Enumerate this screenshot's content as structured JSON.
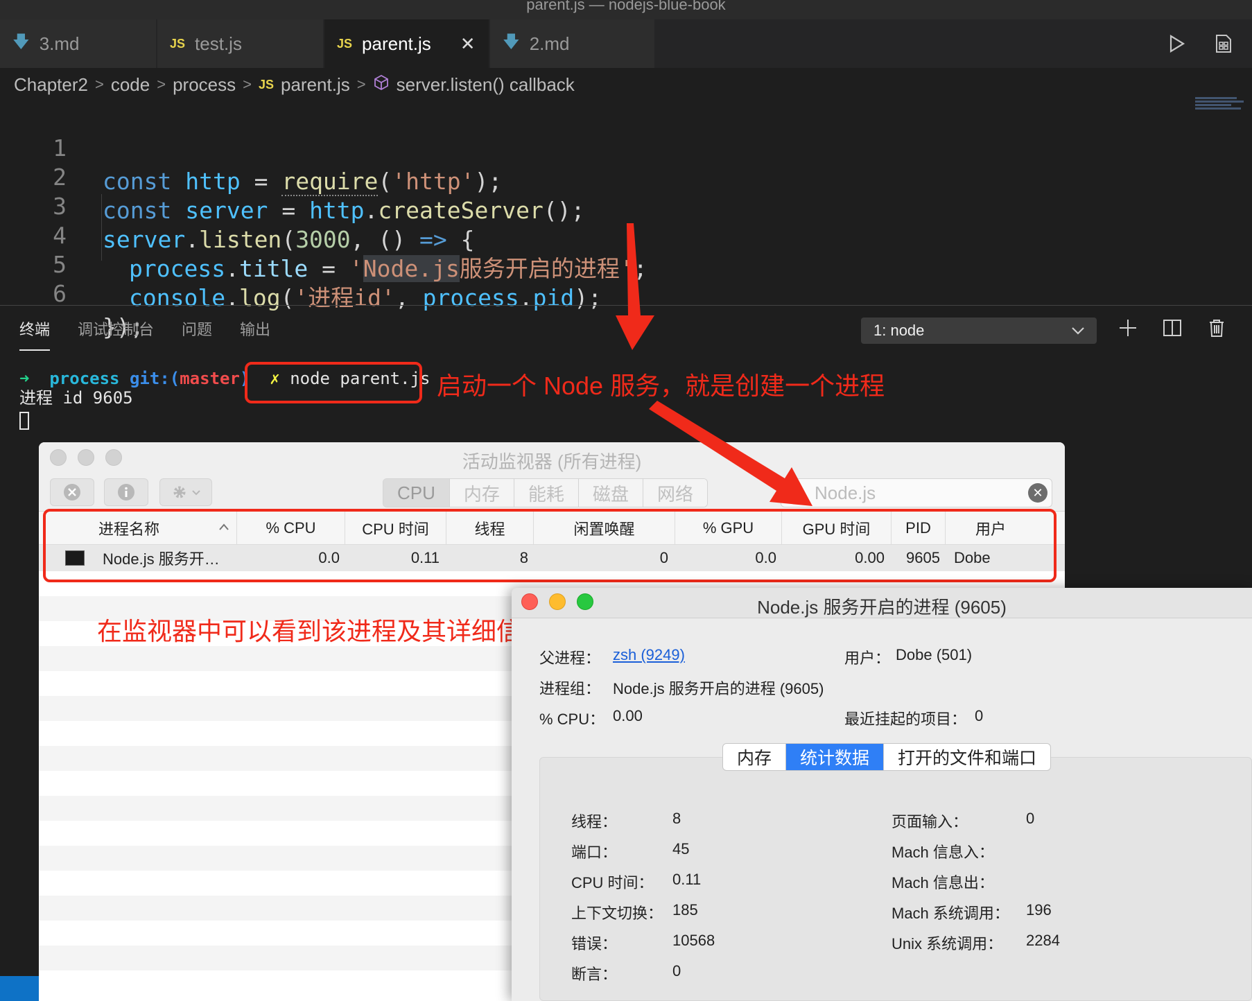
{
  "window": {
    "title": "parent.js — nodejs-blue-book"
  },
  "tabs": [
    {
      "label": "3.md",
      "icon": "markdown-arrow-icon",
      "active": false
    },
    {
      "label": "test.js",
      "icon": "js-icon",
      "active": false
    },
    {
      "label": "parent.js",
      "icon": "js-icon",
      "active": true,
      "close": "✕"
    },
    {
      "label": "2.md",
      "icon": "markdown-arrow-icon",
      "active": false
    }
  ],
  "tab_icons": {
    "js": "JS",
    "md": "🡇"
  },
  "breadcrumb": [
    "Chapter2",
    "code",
    "process",
    "parent.js",
    "server.listen() callback"
  ],
  "code": {
    "line_numbers": [
      "1",
      "2",
      "3",
      "4",
      "5",
      "6"
    ],
    "l1": [
      "const",
      "http",
      "=",
      "require",
      "(",
      "'http'",
      ");"
    ],
    "l2": [
      "const",
      "server",
      "=",
      "http",
      ".",
      "createServer",
      "();"
    ],
    "l3": [
      "server",
      ".",
      "listen",
      "(",
      "3000",
      ", () ",
      "=>",
      " {"
    ],
    "l4": [
      "process",
      ".",
      "title",
      " = ",
      "'",
      "Node.js",
      "服务开启的进程",
      "'",
      ";"
    ],
    "l5": [
      "console",
      ".",
      "log",
      "(",
      "'进程id'",
      ", ",
      "process",
      ".",
      "pid",
      ");"
    ],
    "l6": [
      "});"
    ]
  },
  "panel": {
    "tabs": [
      "终端",
      "调试控制台",
      "问题",
      "输出"
    ],
    "active_tab": "终端",
    "terminal_select": "1: node"
  },
  "terminal": {
    "prompt_arrow": "➜",
    "dir": "process",
    "git": "git:(",
    "branch": "master",
    "git_close": ")",
    "dirty": "✗",
    "command": "node parent.js",
    "output": "进程 id 9605"
  },
  "annotations": {
    "start_service": "启动一个 Node 服务，就是创建一个进程",
    "monitor_note": "在监视器中可以看到该进程及其详细信息"
  },
  "activity_monitor": {
    "title": "活动监视器 (所有进程)",
    "segments": [
      "CPU",
      "内存",
      "能耗",
      "磁盘",
      "网络"
    ],
    "active_segment": "CPU",
    "search_value": "Node.js",
    "columns": [
      "进程名称",
      "% CPU",
      "CPU 时间",
      "线程",
      "闲置唤醒",
      "% GPU",
      "GPU 时间",
      "PID",
      "用户"
    ],
    "row": {
      "name": "Node.js 服务开…",
      "cpu": "0.0",
      "cpu_time": "0.11",
      "threads": "8",
      "idle_wakeups": "0",
      "gpu": "0.0",
      "gpu_time": "0.00",
      "pid": "9605",
      "user": "Dobe"
    }
  },
  "process_info": {
    "title": "Node.js 服务开启的进程 (9605)",
    "parent_label": "父进程：",
    "parent_value": "zsh (9249)",
    "user_label": "用户：",
    "user_value": "Dobe (501)",
    "group_label": "进程组：",
    "group_value": "Node.js 服务开启的进程 (9605)",
    "cpu_label": "% CPU：",
    "cpu_value": "0.00",
    "suspended_label": "最近挂起的项目：",
    "suspended_value": "0",
    "tabs": [
      "内存",
      "统计数据",
      "打开的文件和端口"
    ],
    "active_tab": "统计数据",
    "stats_left": [
      {
        "label": "线程：",
        "value": "8"
      },
      {
        "label": "端口：",
        "value": "45"
      },
      {
        "label": "CPU 时间：",
        "value": "0.11"
      },
      {
        "label": "上下文切换：",
        "value": "185"
      },
      {
        "label": "错误：",
        "value": "10568"
      },
      {
        "label": "断言：",
        "value": "0"
      }
    ],
    "stats_right": [
      {
        "label": "页面输入：",
        "value": "0"
      },
      {
        "label": "Mach 信息入：",
        "value": ""
      },
      {
        "label": "Mach 信息出：",
        "value": ""
      },
      {
        "label": "Mach 系统调用：",
        "value": "196"
      },
      {
        "label": "Unix 系统调用：",
        "value": "2284"
      }
    ]
  },
  "colors": {
    "annotation_red": "#f02a1a",
    "selection_blue": "#2f7ff6"
  }
}
